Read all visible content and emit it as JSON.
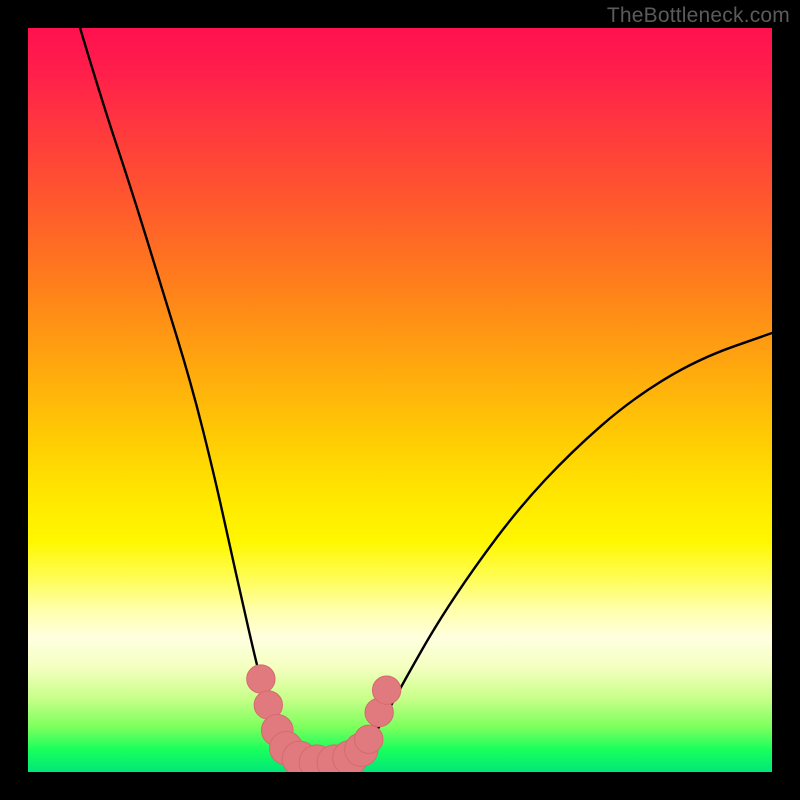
{
  "watermark": {
    "text": "TheBottleneck.com"
  },
  "colors": {
    "frame": "#000000",
    "curve_stroke": "#000000",
    "marker_fill": "#e17a7e",
    "marker_stroke": "#d46a6e",
    "watermark": "#5b5b5b"
  },
  "chart_data": {
    "type": "line",
    "title": "",
    "xlabel": "",
    "ylabel": "",
    "xlim": [
      0,
      100
    ],
    "ylim": [
      0,
      100
    ],
    "grid": false,
    "legend": false,
    "series": [
      {
        "name": "left-branch",
        "x": [
          7,
          10,
          14,
          18,
          22,
          25,
          27,
          29,
          30.5,
          31.5,
          32.5,
          33.3,
          34.0,
          34.8,
          35.6
        ],
        "y": [
          100,
          90,
          78,
          65,
          52,
          40,
          31,
          22,
          15.5,
          11.5,
          8.5,
          6.2,
          4.5,
          3.2,
          2.2
        ]
      },
      {
        "name": "floor",
        "x": [
          35.6,
          37.0,
          39.0,
          41.0,
          43.0,
          44.5
        ],
        "y": [
          2.2,
          1.5,
          1.2,
          1.2,
          1.5,
          2.2
        ]
      },
      {
        "name": "right-branch",
        "x": [
          44.5,
          46.0,
          48.0,
          51.0,
          55.0,
          60.0,
          66.0,
          73.0,
          81.0,
          90.0,
          100.0
        ],
        "y": [
          2.2,
          4.0,
          7.5,
          13.0,
          20.0,
          27.5,
          35.5,
          43.0,
          50.0,
          55.5,
          59.0
        ]
      }
    ],
    "markers": [
      {
        "x": 31.3,
        "y": 12.5,
        "r": 2.0
      },
      {
        "x": 32.3,
        "y": 9.0,
        "r": 2.0
      },
      {
        "x": 33.5,
        "y": 5.6,
        "r": 2.4
      },
      {
        "x": 34.7,
        "y": 3.2,
        "r": 2.6
      },
      {
        "x": 36.5,
        "y": 1.8,
        "r": 2.8
      },
      {
        "x": 38.8,
        "y": 1.3,
        "r": 2.8
      },
      {
        "x": 41.2,
        "y": 1.3,
        "r": 2.8
      },
      {
        "x": 43.3,
        "y": 1.9,
        "r": 2.8
      },
      {
        "x": 44.8,
        "y": 3.0,
        "r": 2.6
      },
      {
        "x": 45.8,
        "y": 4.4,
        "r": 2.0
      },
      {
        "x": 47.2,
        "y": 8.0,
        "r": 2.0
      },
      {
        "x": 48.2,
        "y": 11.0,
        "r": 2.0
      }
    ]
  }
}
